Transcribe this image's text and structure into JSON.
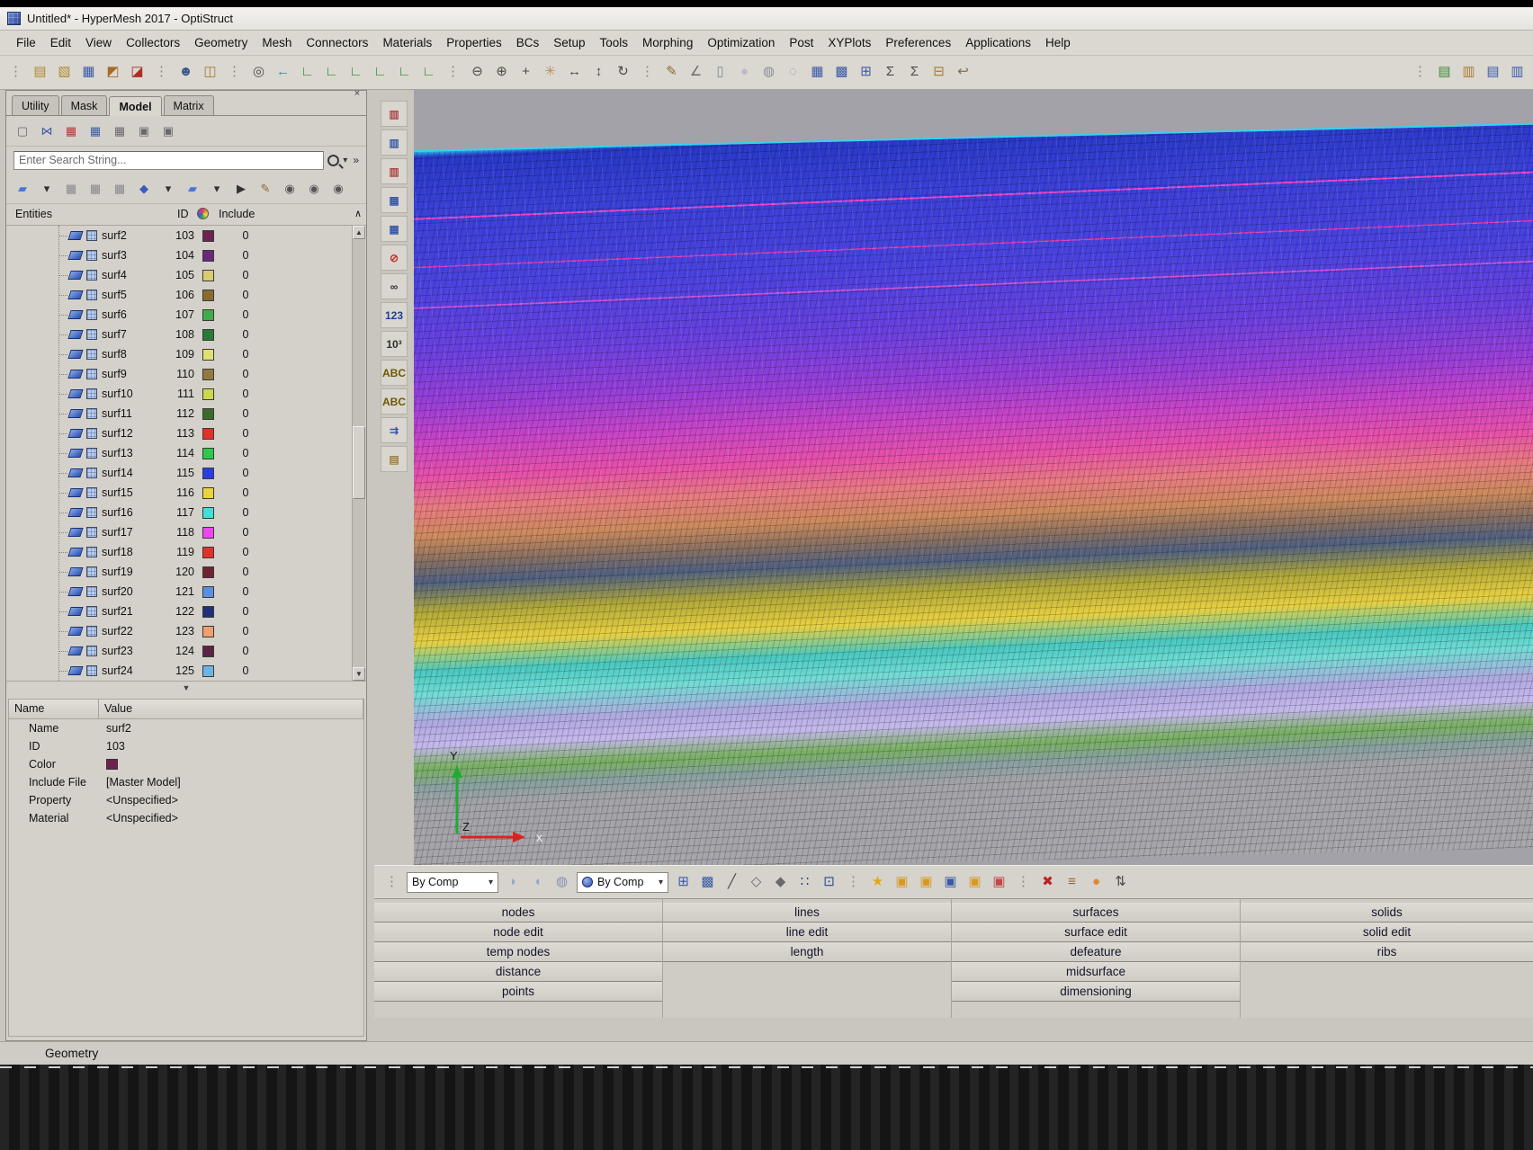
{
  "window": {
    "title": "Untitled* - HyperMesh 2017 - OptiStruct"
  },
  "menubar": {
    "items": [
      "File",
      "Edit",
      "View",
      "Collectors",
      "Geometry",
      "Mesh",
      "Connectors",
      "Materials",
      "Properties",
      "BCs",
      "Setup",
      "Tools",
      "Morphing",
      "Optimization",
      "Post",
      "XYPlots",
      "Preferences",
      "Applications",
      "Help"
    ]
  },
  "main_toolbar": [
    {
      "name": "drag-handle",
      "glyph": "⋮",
      "color": "#8a877f"
    },
    {
      "name": "new-session-icon",
      "glyph": "▤",
      "color": "#b08a30"
    },
    {
      "name": "open-model-icon",
      "glyph": "▧",
      "color": "#b08a30"
    },
    {
      "name": "save-model-icon",
      "glyph": "▦",
      "color": "#3a5aa8"
    },
    {
      "name": "import-icon",
      "glyph": "◩",
      "color": "#a86a28"
    },
    {
      "name": "export-icon",
      "glyph": "◪",
      "color": "#a83028"
    },
    {
      "name": "drag-handle",
      "glyph": "⋮",
      "color": "#8a877f"
    },
    {
      "name": "user-profiles-icon",
      "glyph": "☻",
      "color": "#35568a"
    },
    {
      "name": "organize-icon",
      "glyph": "◫",
      "color": "#a87a30"
    },
    {
      "name": "drag-handle",
      "glyph": "⋮",
      "color": "#8a877f"
    },
    {
      "name": "zoom-icon",
      "glyph": "◎",
      "color": "#4a4a4a"
    },
    {
      "name": "previous-view-icon",
      "glyph": "←",
      "color": "#2f8aa0"
    },
    {
      "name": "view-xy-icon",
      "glyph": "∟",
      "color": "#2a8a2a"
    },
    {
      "name": "view-yx-icon",
      "glyph": "∟",
      "color": "#2a8a2a"
    },
    {
      "name": "view-xz-icon",
      "glyph": "∟",
      "color": "#2a8a2a"
    },
    {
      "name": "view-zx-icon",
      "glyph": "∟",
      "color": "#2a8a2a"
    },
    {
      "name": "view-yz-icon",
      "glyph": "∟",
      "color": "#2a8a2a"
    },
    {
      "name": "view-zy-icon",
      "glyph": "∟",
      "color": "#2a8a2a"
    },
    {
      "name": "drag-handle",
      "glyph": "⋮",
      "color": "#8a877f"
    },
    {
      "name": "zoom-out-icon",
      "glyph": "⊖",
      "color": "#4a4a4a"
    },
    {
      "name": "zoom-in-icon",
      "glyph": "⊕",
      "color": "#4a4a4a"
    },
    {
      "name": "fit-view-icon",
      "glyph": "+",
      "color": "#4a4a4a"
    },
    {
      "name": "pan-hand-icon",
      "glyph": "✳",
      "color": "#b8905a"
    },
    {
      "name": "translate-view-icon",
      "glyph": "↔",
      "color": "#4a4a4a"
    },
    {
      "name": "dynamic-zoom-icon",
      "glyph": "↕",
      "color": "#4a4a4a"
    },
    {
      "name": "rotate-view-icon",
      "glyph": "↻",
      "color": "#4a4a4a"
    },
    {
      "name": "drag-handle",
      "glyph": "⋮",
      "color": "#8a877f"
    },
    {
      "name": "sketch-icon",
      "glyph": "✎",
      "color": "#8a6a3a"
    },
    {
      "name": "measure-angle-icon",
      "glyph": "∠",
      "color": "#6a6a6a"
    },
    {
      "name": "jar-icon",
      "glyph": "▯",
      "color": "#7a8a9a"
    },
    {
      "name": "shaded-sphere-icon",
      "glyph": "●",
      "color": "#b8bcc8"
    },
    {
      "name": "wireframe-sphere-icon",
      "glyph": "◍",
      "color": "#8a8f9c"
    },
    {
      "name": "hidden-line-sphere-icon",
      "glyph": "◌",
      "color": "#8a8f9c"
    },
    {
      "name": "mesh-view-icon",
      "glyph": "▦",
      "color": "#3a5aa8"
    },
    {
      "name": "element-view-icon",
      "glyph": "▩",
      "color": "#3a5aa8"
    },
    {
      "name": "shrink-view-icon",
      "glyph": "⊞",
      "color": "#3a5aa8"
    },
    {
      "name": "summation-icon",
      "glyph": "Σ",
      "color": "#4a4a4a"
    },
    {
      "name": "sort-summation-icon",
      "glyph": "Σ",
      "color": "#4a4a4a"
    },
    {
      "name": "spreadsheet-icon",
      "glyph": "⊟",
      "color": "#a87a30"
    },
    {
      "name": "hook-tool-icon",
      "glyph": "↩",
      "color": "#8a6a4a"
    }
  ],
  "main_toolbar_right": [
    {
      "name": "drag-handle",
      "glyph": "⋮",
      "color": "#8a877f"
    },
    {
      "name": "include-browser-icon",
      "glyph": "▤",
      "color": "#3a8a3a"
    },
    {
      "name": "entity-browser-icon",
      "glyph": "▥",
      "color": "#a87a30"
    },
    {
      "name": "doc-export-icon",
      "glyph": "▤",
      "color": "#3a5aa8"
    },
    {
      "name": "doc-list-icon",
      "glyph": "▥",
      "color": "#3a5aa8"
    }
  ],
  "tabs": {
    "items": [
      "Utility",
      "Mask",
      "Model",
      "Matrix"
    ],
    "active": "Model"
  },
  "browser_toolbar_1": [
    {
      "name": "entity-type-icon",
      "glyph": "▢",
      "color": "#666666"
    },
    {
      "name": "link-browser-icon",
      "glyph": "⋈",
      "color": "#3a5aa8"
    },
    {
      "name": "include-grid-icon",
      "glyph": "▦",
      "color": "#b03838"
    },
    {
      "name": "component-grid-icon",
      "glyph": "▦",
      "color": "#3a5aa8"
    },
    {
      "name": "assembly-grid-icon",
      "glyph": "▦",
      "color": "#6a6a6a"
    },
    {
      "name": "stack-cubes-icon-1",
      "glyph": "▣",
      "color": "#6a6a6a"
    },
    {
      "name": "stack-cubes-icon-2",
      "glyph": "▣",
      "color": "#6a6a6a"
    }
  ],
  "search": {
    "placeholder": "Enter Search String..."
  },
  "browser_toolbar_2": [
    {
      "name": "surface-filter-icon",
      "glyph": "▰",
      "color": "#4878d8"
    },
    {
      "name": "dropdown-arrow-icon",
      "glyph": "▾",
      "color": "#333333"
    },
    {
      "name": "eye-grid-icon-1",
      "glyph": "▦",
      "color": "#888888"
    },
    {
      "name": "eye-grid-icon-2",
      "glyph": "▦",
      "color": "#888888"
    },
    {
      "name": "eye-grid-icon-3",
      "glyph": "▦",
      "color": "#888888"
    },
    {
      "name": "element-filter-icon",
      "glyph": "◆",
      "color": "#3a5ac0"
    },
    {
      "name": "dropdown-arrow-icon",
      "glyph": "▾",
      "color": "#333333"
    },
    {
      "name": "surface-pair-icon",
      "glyph": "▰",
      "color": "#4878d8"
    },
    {
      "name": "dropdown-arrow-icon",
      "glyph": "▾",
      "color": "#333333"
    },
    {
      "name": "pointer-icon",
      "glyph": "▶",
      "color": "#333333"
    },
    {
      "name": "paint-brush-icon",
      "glyph": "✎",
      "color": "#8a6a3a"
    },
    {
      "name": "eye-show-hide-icon",
      "glyph": "◉",
      "color": "#555555"
    },
    {
      "name": "eye-plusminus-icon",
      "glyph": "◉",
      "color": "#555555"
    },
    {
      "name": "eye-isolate-icon",
      "glyph": "◉",
      "color": "#555555"
    }
  ],
  "entities": {
    "title": "Entities",
    "col_id": "ID",
    "col_include": "Include",
    "rows": [
      {
        "name": "surf2",
        "id": "103",
        "color": "#6e2250",
        "include": "0"
      },
      {
        "name": "surf3",
        "id": "104",
        "color": "#6a2878",
        "include": "0"
      },
      {
        "name": "surf4",
        "id": "105",
        "color": "#d8cc70",
        "include": "0"
      },
      {
        "name": "surf5",
        "id": "106",
        "color": "#8a6a30",
        "include": "0"
      },
      {
        "name": "surf6",
        "id": "107",
        "color": "#42aa4e",
        "include": "0"
      },
      {
        "name": "surf7",
        "id": "108",
        "color": "#2a7a38",
        "include": "0"
      },
      {
        "name": "surf8",
        "id": "109",
        "color": "#e0e070",
        "include": "0"
      },
      {
        "name": "surf9",
        "id": "110",
        "color": "#907a40",
        "include": "0"
      },
      {
        "name": "surf10",
        "id": "111",
        "color": "#ccd84e",
        "include": "0"
      },
      {
        "name": "surf11",
        "id": "112",
        "color": "#3c6a30",
        "include": "0"
      },
      {
        "name": "surf12",
        "id": "113",
        "color": "#e43028",
        "include": "0"
      },
      {
        "name": "surf13",
        "id": "114",
        "color": "#2ec84a",
        "include": "0"
      },
      {
        "name": "surf14",
        "id": "115",
        "color": "#2a3ee0",
        "include": "0"
      },
      {
        "name": "surf15",
        "id": "116",
        "color": "#ecd23c",
        "include": "0"
      },
      {
        "name": "surf16",
        "id": "117",
        "color": "#3ee0d8",
        "include": "0"
      },
      {
        "name": "surf17",
        "id": "118",
        "color": "#ee46ee",
        "include": "0"
      },
      {
        "name": "surf18",
        "id": "119",
        "color": "#e43028",
        "include": "0"
      },
      {
        "name": "surf19",
        "id": "120",
        "color": "#6e2432",
        "include": "0"
      },
      {
        "name": "surf20",
        "id": "121",
        "color": "#5a8ee0",
        "include": "0"
      },
      {
        "name": "surf21",
        "id": "122",
        "color": "#22307a",
        "include": "0"
      },
      {
        "name": "surf22",
        "id": "123",
        "color": "#eea070",
        "include": "0"
      },
      {
        "name": "surf23",
        "id": "124",
        "color": "#5e2244",
        "include": "0"
      },
      {
        "name": "surf24",
        "id": "125",
        "color": "#6ab4e6",
        "include": "0"
      }
    ]
  },
  "properties": {
    "header_name": "Name",
    "header_value": "Value",
    "name_label": "Name",
    "name_value": "surf2",
    "id_label": "ID",
    "id_value": "103",
    "color_label": "Color",
    "color_value": "#6e2250",
    "include_file_label": "Include File",
    "include_file_value": "[Master Model]",
    "property_label": "Property",
    "property_value": "<Unspecified>",
    "material_label": "Material",
    "material_value": "<Unspecified>"
  },
  "vertical_toolbar": [
    {
      "name": "display-card-icon-1",
      "glyph": "▥",
      "color": "#b04848"
    },
    {
      "name": "display-card-icon-2",
      "glyph": "▥",
      "color": "#3a5aa8"
    },
    {
      "name": "display-card-icon-3",
      "glyph": "▥",
      "color": "#b04848"
    },
    {
      "name": "display-grid-icon-1",
      "glyph": "▦",
      "color": "#3a5aa8"
    },
    {
      "name": "display-grid-icon-2",
      "glyph": "▦",
      "color": "#3a5aa8"
    },
    {
      "name": "spherical-clip-icon",
      "glyph": "⊘",
      "color": "#c03030"
    },
    {
      "name": "find-binoculars-icon",
      "glyph": "∞",
      "color": "#303030"
    },
    {
      "name": "numbers-123-icon",
      "glyph": "123",
      "color": "#203f90"
    },
    {
      "name": "exponent-format-icon",
      "glyph": "10³",
      "color": "#303030"
    },
    {
      "name": "label-abc-icon",
      "glyph": "ABC",
      "color": "#705800"
    },
    {
      "name": "label-abc-outline-icon",
      "glyph": "ABC",
      "color": "#705800"
    },
    {
      "name": "vector-display-icon",
      "glyph": "⇉",
      "color": "#3a5aa8"
    },
    {
      "name": "scroll-list-icon",
      "glyph": "▤",
      "color": "#a08040"
    }
  ],
  "viewport": {
    "axis": {
      "y_label": "Y",
      "z_label": "Z",
      "x_label": "x",
      "y_color": "#22aa33",
      "x_color": "#dd2222"
    },
    "top_edge_color": "#35d2f2",
    "bands": [
      {
        "c": "#28c8e8",
        "p": 0
      },
      {
        "c": "#2838c8",
        "p": 0.8
      },
      {
        "c": "#3a40d8",
        "p": 8
      },
      {
        "c": "#4a42e0",
        "p": 18
      },
      {
        "c": "#6a40e0",
        "p": 27
      },
      {
        "c": "#9a3ed8",
        "p": 34
      },
      {
        "c": "#c843c8",
        "p": 39
      },
      {
        "c": "#e850a8",
        "p": 44
      },
      {
        "c": "#e87a80",
        "p": 48
      },
      {
        "c": "#cc8a5c",
        "p": 52
      },
      {
        "c": "#8a7060",
        "p": 55
      },
      {
        "c": "#506080",
        "p": 58
      },
      {
        "c": "#b0a838",
        "p": 62
      },
      {
        "c": "#e8d040",
        "p": 66
      },
      {
        "c": "#48c8c0",
        "p": 70
      },
      {
        "c": "#70dcd4",
        "p": 73
      },
      {
        "c": "#b0a8e0",
        "p": 77
      },
      {
        "c": "#c4b8ec",
        "p": 80
      },
      {
        "c": "#78b060",
        "p": 83
      },
      {
        "c": "#88a0a0",
        "p": 85.5
      },
      {
        "c": "#a2a2a8",
        "p": 88
      },
      {
        "c": "#a6a6ac",
        "p": 100
      }
    ]
  },
  "bottom_toolbar": {
    "mode1": "By Comp",
    "mode2": "By Comp",
    "icons_pre": [
      {
        "name": "drag-handle",
        "glyph": "⋮",
        "color": "#8a877f"
      }
    ],
    "icons_mid": [
      {
        "name": "geometry-shaded-icon",
        "glyph": "◗",
        "color": "#98a8c8"
      },
      {
        "name": "geometry-wireframe-icon",
        "glyph": "◖",
        "color": "#98a8c8"
      },
      {
        "name": "geometry-edges-icon",
        "glyph": "◍",
        "color": "#8090b8"
      }
    ],
    "icons_post": [
      {
        "name": "mesh-style-icon",
        "glyph": "⊞",
        "color": "#3a5aa8"
      },
      {
        "name": "element-color-icon",
        "glyph": "▩",
        "color": "#3a5aa8"
      },
      {
        "name": "feature-lines-icon",
        "glyph": "╱",
        "color": "#4a4a4a"
      },
      {
        "name": "element-quality-icon",
        "glyph": "◇",
        "color": "#6a6a6a"
      },
      {
        "name": "element-normals-icon",
        "glyph": "◆",
        "color": "#6a6a6a"
      },
      {
        "name": "node-display-icon",
        "glyph": "∷",
        "color": "#2a4a9a"
      },
      {
        "name": "monitor-icon",
        "glyph": "⊡",
        "color": "#2a4a8a"
      },
      {
        "name": "drag-handle",
        "glyph": "⋮",
        "color": "#8a877f"
      },
      {
        "name": "highlight-star-icon",
        "glyph": "★",
        "color": "#e0a818"
      },
      {
        "name": "entity-folder-icon-1",
        "glyph": "▣",
        "color": "#d89820"
      },
      {
        "name": "entity-folder-icon-2",
        "glyph": "▣",
        "color": "#d89820"
      },
      {
        "name": "entity-folder-icon-3",
        "glyph": "▣",
        "color": "#3a5aa8"
      },
      {
        "name": "entity-folder-icon-4",
        "glyph": "▣",
        "color": "#d89820"
      },
      {
        "name": "entity-import-icon",
        "glyph": "▣",
        "color": "#c04848"
      },
      {
        "name": "drag-handle",
        "glyph": "⋮",
        "color": "#8a877f"
      },
      {
        "name": "delete-x-icon",
        "glyph": "✖",
        "color": "#c02020"
      },
      {
        "name": "layers-icon",
        "glyph": "≡",
        "color": "#8a6a4a"
      },
      {
        "name": "clay-mode-icon",
        "glyph": "●",
        "color": "#e08830"
      },
      {
        "name": "renumber-icon",
        "glyph": "⇅",
        "color": "#4a4a4a"
      }
    ]
  },
  "panels": {
    "col1": [
      "nodes",
      "node edit",
      "temp nodes",
      "distance",
      "points"
    ],
    "col2": [
      "lines",
      "line edit",
      "length"
    ],
    "col3": [
      "surfaces",
      "surface edit",
      "defeature",
      "midsurface",
      "dimensioning"
    ],
    "col4": [
      "solids",
      "solid edit",
      "ribs"
    ]
  },
  "statusbar": {
    "label": "Geometry"
  }
}
